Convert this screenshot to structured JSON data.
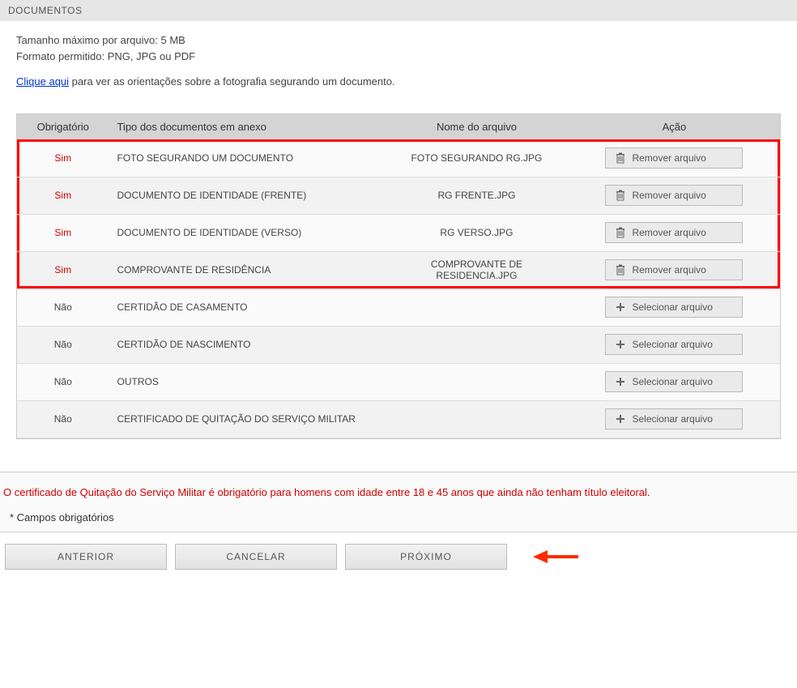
{
  "header": {
    "title": "DOCUMENTOS"
  },
  "info": {
    "max_size": "Tamanho máximo por arquivo: 5 MB",
    "formats": "Formato permitido: PNG, JPG ou PDF",
    "link_text": "Clique aqui",
    "link_rest": " para ver as orientações sobre a fotografia segurando um documento."
  },
  "table": {
    "headers": {
      "obrigatorio": "Obrigatório",
      "tipo": "Tipo dos documentos em anexo",
      "nome": "Nome do arquivo",
      "acao": "Ação"
    },
    "rows": [
      {
        "obrig": "Sim",
        "obrig_class": "sim",
        "tipo": "FOTO SEGURANDO UM DOCUMENTO",
        "nome": "FOTO SEGURANDO RG.JPG",
        "action": "remove",
        "action_label": "Remover arquivo",
        "hl": true
      },
      {
        "obrig": "Sim",
        "obrig_class": "sim",
        "tipo": "DOCUMENTO DE IDENTIDADE (FRENTE)",
        "nome": "RG FRENTE.JPG",
        "action": "remove",
        "action_label": "Remover arquivo",
        "hl": true
      },
      {
        "obrig": "Sim",
        "obrig_class": "sim",
        "tipo": "DOCUMENTO DE IDENTIDADE (VERSO)",
        "nome": "RG VERSO.JPG",
        "action": "remove",
        "action_label": "Remover arquivo",
        "hl": true
      },
      {
        "obrig": "Sim",
        "obrig_class": "sim",
        "tipo": "COMPROVANTE DE RESIDÊNCIA",
        "nome": "COMPROVANTE DE RESIDENCIA.JPG",
        "action": "remove",
        "action_label": "Remover arquivo",
        "hl": true
      },
      {
        "obrig": "Não",
        "obrig_class": "nao",
        "tipo": "CERTIDÃO DE CASAMENTO",
        "nome": "",
        "action": "select",
        "action_label": "Selecionar arquivo",
        "hl": false
      },
      {
        "obrig": "Não",
        "obrig_class": "nao",
        "tipo": "CERTIDÃO DE NASCIMENTO",
        "nome": "",
        "action": "select",
        "action_label": "Selecionar arquivo",
        "hl": false
      },
      {
        "obrig": "Não",
        "obrig_class": "nao",
        "tipo": "OUTROS",
        "nome": "",
        "action": "select",
        "action_label": "Selecionar arquivo",
        "hl": false
      },
      {
        "obrig": "Não",
        "obrig_class": "nao",
        "tipo": "CERTIFICADO DE QUITAÇÃO DO SERVIÇO MILITAR",
        "nome": "",
        "action": "select",
        "action_label": "Selecionar arquivo",
        "hl": false
      }
    ]
  },
  "notice": {
    "text": "O certificado de Quitação do Serviço Militar é obrigatório para homens com idade entre 18 e 45 anos que ainda não tenham título eleitoral.",
    "required_fields": "* Campos obrigatórios"
  },
  "nav": {
    "anterior": "ANTERIOR",
    "cancelar": "CANCELAR",
    "proximo": "PRÓXIMO"
  }
}
